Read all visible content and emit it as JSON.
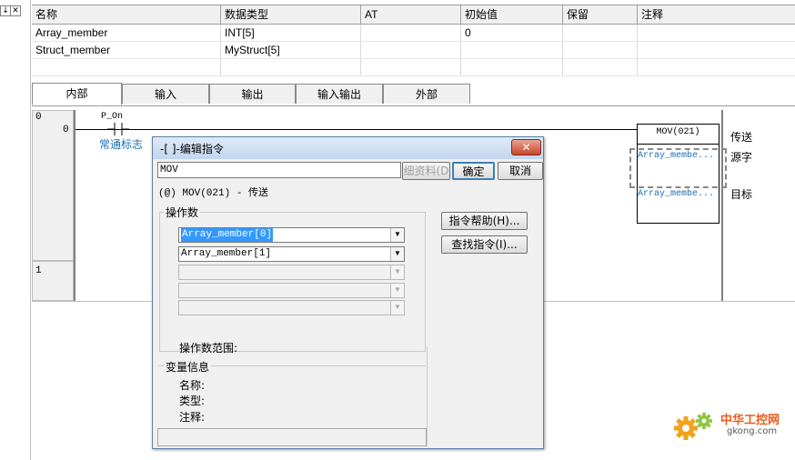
{
  "window": {
    "pin_glyph": "↓",
    "close_glyph": "✕"
  },
  "var_table": {
    "columns": [
      "名称",
      "数据类型",
      "AT",
      "初始值",
      "保留",
      "注释"
    ],
    "rows": [
      {
        "name": "Array_member",
        "type": "INT[5]",
        "at": "",
        "init": "0",
        "retain": "",
        "comment": ""
      },
      {
        "name": "Struct_member",
        "type": "MyStruct[5]",
        "at": "",
        "init": "",
        "retain": "",
        "comment": ""
      }
    ]
  },
  "tabs": [
    {
      "label": "内部",
      "active": true
    },
    {
      "label": "输入",
      "active": false
    },
    {
      "label": "输出",
      "active": false
    },
    {
      "label": "输入输出",
      "active": false
    },
    {
      "label": "外部",
      "active": false
    }
  ],
  "ladder": {
    "rung0_number": "0",
    "rung0_step": "0",
    "rung1_number": "1",
    "contact_label": "P_On",
    "contact_desc": "常通标志",
    "instruction": "MOV(021)",
    "source_operand": "Array_membe...",
    "dest_operand": "Array_membe...",
    "label_transfer": "传送",
    "label_source": "源字",
    "label_dest": "目标"
  },
  "dialog": {
    "title": "-[ ]-编辑指令",
    "close_glyph": "✕",
    "instruction_input": "MOV",
    "detail_button": "细资料(D",
    "ok_button": "确定",
    "cancel_button": "取消",
    "instruction_desc": "(@) MOV(021) - 传送",
    "operand_group": "操作数",
    "operands": [
      "Array_member[0]",
      "Array_member[1]",
      "",
      "",
      ""
    ],
    "operand_range": "操作数范围:",
    "help_button": "指令帮助(H)...",
    "find_button": "查找指令(I)...",
    "var_info_group": "变量信息",
    "info_name": "名称:",
    "info_type": "类型:",
    "info_comment": "注释:"
  },
  "watermark": {
    "cn": "中华工控网",
    "url": "gkong.com"
  },
  "colors": {
    "accent_blue": "#1b6fb5",
    "selection": "#3399ff",
    "watermark_orange": "#e95a1c"
  }
}
